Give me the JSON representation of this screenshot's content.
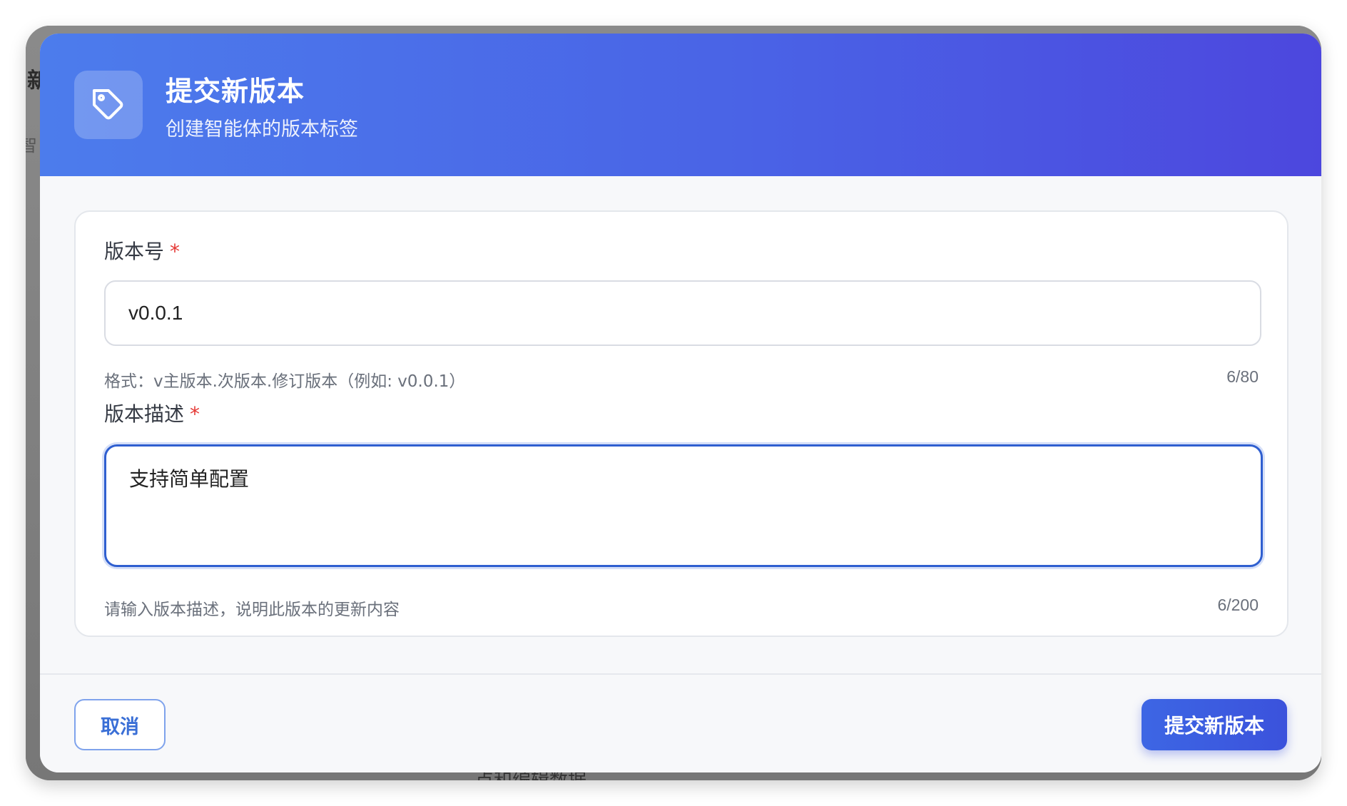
{
  "background": {
    "partial_char_1": "新",
    "partial_char_2": "智",
    "bottom_text": "点和编辑数据"
  },
  "modal": {
    "title": "提交新版本",
    "subtitle": "创建智能体的版本标签",
    "header_icon": "tag-icon",
    "version_field": {
      "label": "版本号",
      "required_mark": "*",
      "value": "v0.0.1",
      "hint": "格式：v主版本.次版本.修订版本（例如: v0.0.1）",
      "counter": "6/80"
    },
    "description_field": {
      "label": "版本描述",
      "required_mark": "*",
      "value": "支持简单配置",
      "hint": "请输入版本描述，说明此版本的更新内容",
      "counter": "6/200"
    },
    "footer": {
      "cancel_label": "取消",
      "submit_label": "提交新版本"
    }
  },
  "colors": {
    "header_gradient_start": "#4c7cec",
    "header_gradient_end": "#4c47de",
    "primary": "#3d66e4",
    "required": "#e53935",
    "focus_border": "#2f5fd0"
  }
}
